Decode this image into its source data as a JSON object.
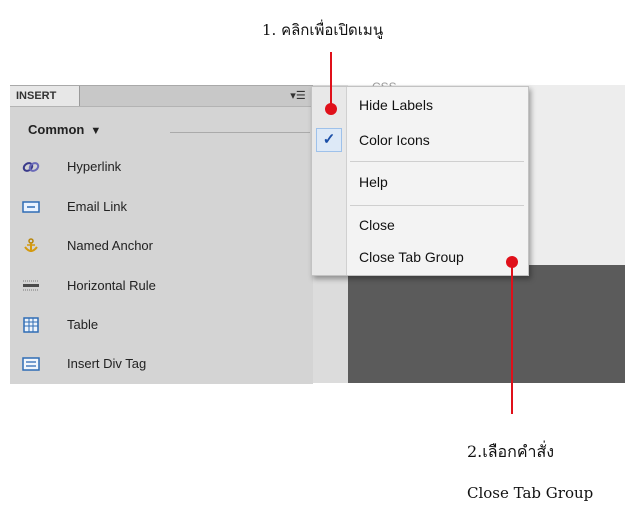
{
  "annotations": {
    "step1": "1. คลิกเพื่อเปิดเมนู",
    "step2": "2.เลือกคำสั่ง",
    "step2_detail": "Close Tab Group",
    "accent": "#e0101a"
  },
  "panel": {
    "tab_label": "INSERT",
    "menu_button_glyph": "▾☰",
    "category": "Common",
    "items": [
      {
        "label": "Hyperlink",
        "icon": "hyperlink-icon"
      },
      {
        "label": "Email Link",
        "icon": "email-link-icon"
      },
      {
        "label": "Named Anchor",
        "icon": "anchor-icon"
      },
      {
        "label": "Horizontal Rule",
        "icon": "horizontal-rule-icon"
      },
      {
        "label": "Table",
        "icon": "table-icon"
      },
      {
        "label": "Insert Div Tag",
        "icon": "div-tag-icon"
      }
    ]
  },
  "background_text": "CSS",
  "menu": {
    "items": [
      {
        "label": "Hide Labels",
        "checked": false
      },
      {
        "label": "Color Icons",
        "checked": true
      },
      {
        "label": "Help",
        "checked": false
      },
      {
        "label": "Close",
        "checked": false
      },
      {
        "label": "Close Tab Group",
        "checked": false
      }
    ],
    "check_glyph": "✓"
  }
}
